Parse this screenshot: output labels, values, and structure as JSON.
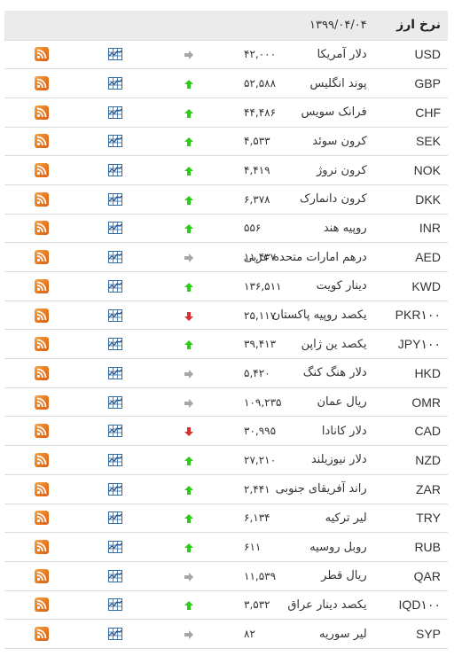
{
  "header": {
    "title": "نرخ ارز",
    "date": "۱۳۹۹/۰۴/۰۴"
  },
  "colors": {
    "up": "#2ecc1a",
    "down": "#d63131",
    "flat": "#a6a6a6",
    "rss": "#f0852a",
    "chart": "#2f6aa8",
    "header_bg": "#ebebeb"
  },
  "rows": [
    {
      "code": "USD",
      "name": "دلار آمریکا",
      "price": "۴۲,۰۰۰",
      "trend": "flat",
      "trend_icon": "arrow-right-icon",
      "chart_icon": "line-chart-icon",
      "rss_icon": "rss-icon"
    },
    {
      "code": "GBP",
      "name": "پوند انگلیس",
      "price": "۵۲,۵۸۸",
      "trend": "up",
      "trend_icon": "arrow-up-icon",
      "chart_icon": "line-chart-icon",
      "rss_icon": "rss-icon"
    },
    {
      "code": "CHF",
      "name": "فرانک سویس",
      "price": "۴۴,۴۸۶",
      "trend": "up",
      "trend_icon": "arrow-up-icon",
      "chart_icon": "line-chart-icon",
      "rss_icon": "rss-icon"
    },
    {
      "code": "SEK",
      "name": "کرون سوئد",
      "price": "۴,۵۳۳",
      "trend": "up",
      "trend_icon": "arrow-up-icon",
      "chart_icon": "line-chart-icon",
      "rss_icon": "rss-icon"
    },
    {
      "code": "NOK",
      "name": "کرون نروژ",
      "price": "۴,۴۱۹",
      "trend": "up",
      "trend_icon": "arrow-up-icon",
      "chart_icon": "line-chart-icon",
      "rss_icon": "rss-icon"
    },
    {
      "code": "DKK",
      "name": "کرون دانمارک",
      "price": "۶,۳۷۸",
      "trend": "up",
      "trend_icon": "arrow-up-icon",
      "chart_icon": "line-chart-icon",
      "rss_icon": "rss-icon"
    },
    {
      "code": "INR",
      "name": "روپیه هند",
      "price": "۵۵۶",
      "trend": "up",
      "trend_icon": "arrow-up-icon",
      "chart_icon": "line-chart-icon",
      "rss_icon": "rss-icon"
    },
    {
      "code": "AED",
      "name": "درهم امارات متحده عربی",
      "price": "۱۱,۴۳۷",
      "trend": "flat",
      "trend_icon": "arrow-right-icon",
      "chart_icon": "line-chart-icon",
      "rss_icon": "rss-icon"
    },
    {
      "code": "KWD",
      "name": "دینار کویت",
      "price": "۱۳۶,۵۱۱",
      "trend": "up",
      "trend_icon": "arrow-up-icon",
      "chart_icon": "line-chart-icon",
      "rss_icon": "rss-icon"
    },
    {
      "code": "PKR۱۰۰",
      "name": "یکصد روپیه پاکستان",
      "price": "۲۵,۱۱۷",
      "trend": "down",
      "trend_icon": "arrow-down-icon",
      "chart_icon": "line-chart-icon",
      "rss_icon": "rss-icon"
    },
    {
      "code": "JPY۱۰۰",
      "name": "یکصد ین ژاپن",
      "price": "۳۹,۴۱۳",
      "trend": "up",
      "trend_icon": "arrow-up-icon",
      "chart_icon": "line-chart-icon",
      "rss_icon": "rss-icon"
    },
    {
      "code": "HKD",
      "name": "دلار هنگ کنگ",
      "price": "۵,۴۲۰",
      "trend": "flat",
      "trend_icon": "arrow-right-icon",
      "chart_icon": "line-chart-icon",
      "rss_icon": "rss-icon"
    },
    {
      "code": "OMR",
      "name": "ریال عمان",
      "price": "۱۰۹,۲۳۵",
      "trend": "flat",
      "trend_icon": "arrow-right-icon",
      "chart_icon": "line-chart-icon",
      "rss_icon": "rss-icon"
    },
    {
      "code": "CAD",
      "name": "دلار کانادا",
      "price": "۳۰,۹۹۵",
      "trend": "down",
      "trend_icon": "arrow-down-icon",
      "chart_icon": "line-chart-icon",
      "rss_icon": "rss-icon"
    },
    {
      "code": "NZD",
      "name": "دلار نیوزیلند",
      "price": "۲۷,۲۱۰",
      "trend": "up",
      "trend_icon": "arrow-up-icon",
      "chart_icon": "line-chart-icon",
      "rss_icon": "rss-icon"
    },
    {
      "code": "ZAR",
      "name": "راند آفریقای جنوبی",
      "price": "۲,۴۴۱",
      "trend": "up",
      "trend_icon": "arrow-up-icon",
      "chart_icon": "line-chart-icon",
      "rss_icon": "rss-icon"
    },
    {
      "code": "TRY",
      "name": "لیر ترکیه",
      "price": "۶,۱۳۴",
      "trend": "up",
      "trend_icon": "arrow-up-icon",
      "chart_icon": "line-chart-icon",
      "rss_icon": "rss-icon"
    },
    {
      "code": "RUB",
      "name": "روبل روسیه",
      "price": "۶۱۱",
      "trend": "up",
      "trend_icon": "arrow-up-icon",
      "chart_icon": "line-chart-icon",
      "rss_icon": "rss-icon"
    },
    {
      "code": "QAR",
      "name": "ریال قطر",
      "price": "۱۱,۵۳۹",
      "trend": "flat",
      "trend_icon": "arrow-right-icon",
      "chart_icon": "line-chart-icon",
      "rss_icon": "rss-icon"
    },
    {
      "code": "IQD۱۰۰",
      "name": "یکصد دینار عراق",
      "price": "۳,۵۳۲",
      "trend": "up",
      "trend_icon": "arrow-up-icon",
      "chart_icon": "line-chart-icon",
      "rss_icon": "rss-icon"
    },
    {
      "code": "SYP",
      "name": "لیر سوریه",
      "price": "۸۲",
      "trend": "flat",
      "trend_icon": "arrow-right-icon",
      "chart_icon": "line-chart-icon",
      "rss_icon": "rss-icon"
    }
  ]
}
